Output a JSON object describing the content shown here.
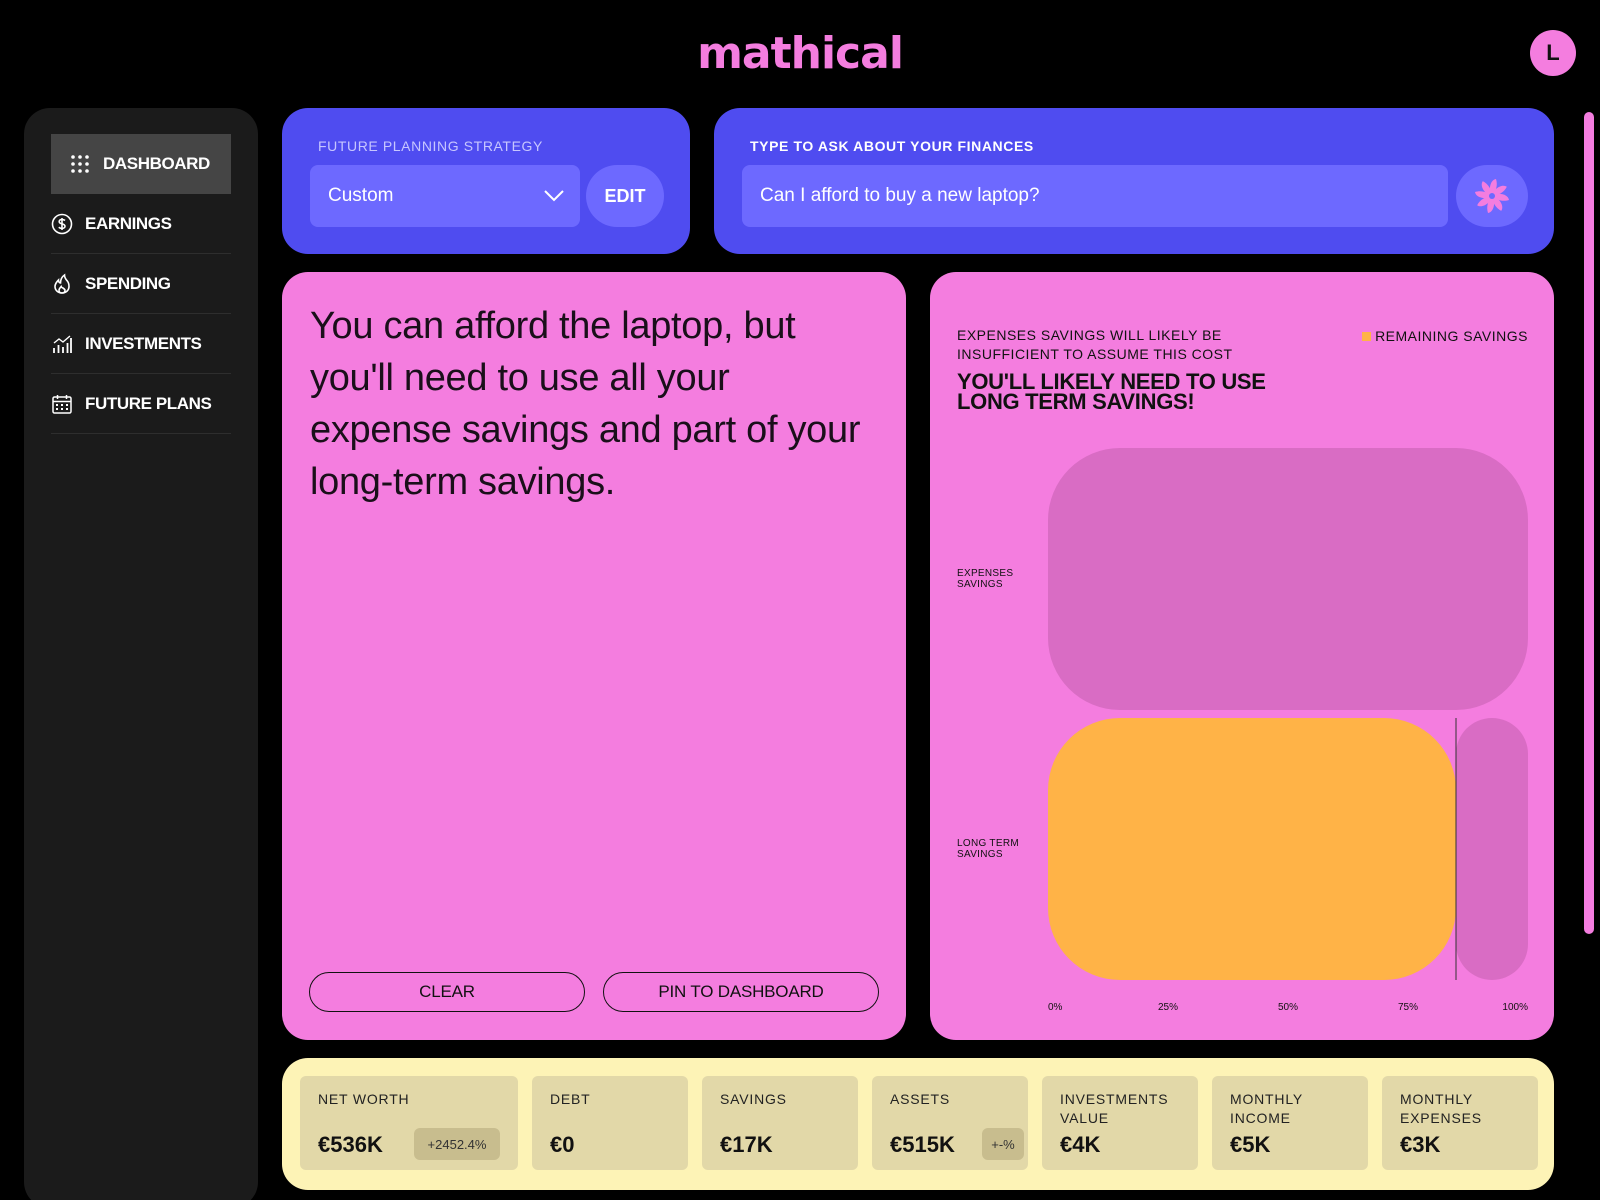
{
  "app": {
    "logo": "mathical",
    "user_initial": "L"
  },
  "sidebar": {
    "items": [
      {
        "label": "DASHBOARD",
        "icon": "grid-icon",
        "active": true
      },
      {
        "label": "EARNINGS",
        "icon": "dollar-icon"
      },
      {
        "label": "SPENDING",
        "icon": "flame-icon"
      },
      {
        "label": "INVESTMENTS",
        "icon": "chart-icon"
      },
      {
        "label": "FUTURE PLANS",
        "icon": "calendar-icon"
      }
    ]
  },
  "strategy": {
    "label": "FUTURE PLANNING STRATEGY",
    "selected": "Custom",
    "edit_label": "EDIT"
  },
  "ask": {
    "label": "TYPE TO ASK ABOUT YOUR FINANCES",
    "value": "Can I afford to buy a new laptop?"
  },
  "answer": {
    "text": "You can afford the laptop, but you'll need to use all your expense savings and part of your long-term savings.",
    "clear_label": "CLEAR",
    "pin_label": "PIN TO DASHBOARD"
  },
  "chart_data": {
    "type": "bar",
    "orientation": "horizontal",
    "subtitle": "EXPENSES SAVINGS WILL LIKELY BE INSUFFICIENT TO ASSUME THIS COST",
    "title": "YOU'LL LIKELY NEED TO USE LONG TERM SAVINGS!",
    "legend": [
      "REMAINING SAVINGS"
    ],
    "legend_position": "top-right",
    "categories": [
      "EXPENSES SAVINGS",
      "LONG TERM SAVINGS"
    ],
    "series": [
      {
        "name": "REMAINING SAVINGS",
        "values": [
          0,
          85
        ]
      }
    ],
    "xlim": [
      0,
      100
    ],
    "x_ticks": [
      "0%",
      "25%",
      "50%",
      "75%",
      "100%"
    ],
    "marker_value": 85,
    "colors": {
      "remaining": "#ffb347",
      "track": "#d96cc4"
    }
  },
  "stats": [
    {
      "label": "NET WORTH",
      "value": "€536K",
      "badge": "+2452.4%"
    },
    {
      "label": "DEBT",
      "value": "€0"
    },
    {
      "label": "SAVINGS",
      "value": "€17K"
    },
    {
      "label": "ASSETS",
      "value": "€515K",
      "badge": "+-%"
    },
    {
      "label": "INVESTMENTS VALUE",
      "value": "€4K"
    },
    {
      "label": "MONTHLY INCOME",
      "value": "€5K"
    },
    {
      "label": "MONTHLY EXPENSES",
      "value": "€3K"
    }
  ],
  "colors": {
    "accent": "#f47ddf",
    "primary": "#4f4cf0",
    "stats_bg": "#fdf3b6"
  }
}
